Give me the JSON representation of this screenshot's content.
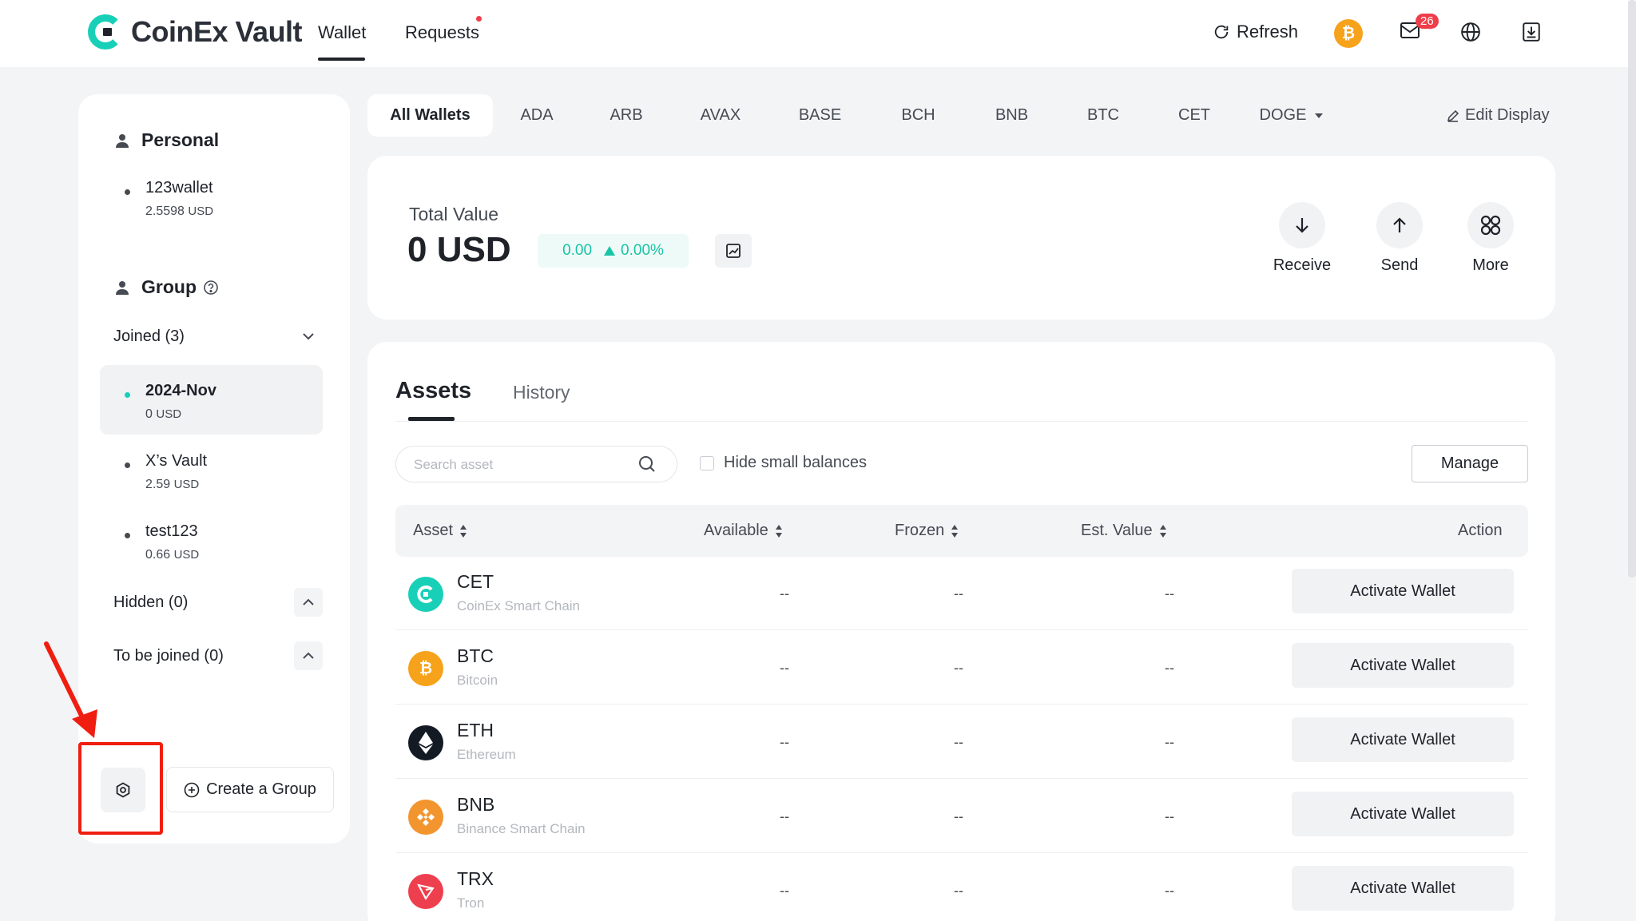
{
  "app": {
    "logo_text": "CoinEx Vault",
    "nav": {
      "wallet": "Wallet",
      "requests": "Requests"
    },
    "refresh": "Refresh",
    "coin_badge": "₿",
    "mail_count": "26"
  },
  "sidebar": {
    "personal_title": "Personal",
    "personal_wallets": [
      {
        "name": "123wallet",
        "amount": "2.5598",
        "unit": "USD"
      }
    ],
    "group_title": "Group",
    "joined_label": "Joined (3)",
    "joined_wallets": [
      {
        "name": "2024-Nov",
        "amount": "0",
        "unit": "USD"
      },
      {
        "name": "X’s Vault",
        "amount": "2.59",
        "unit": "USD"
      },
      {
        "name": "test123",
        "amount": "0.66",
        "unit": "USD"
      }
    ],
    "hidden_label": "Hidden (0)",
    "to_be_joined_label": "To be joined (0)",
    "create_group": "Create a Group"
  },
  "coin_tabs": [
    "All Wallets",
    "ADA",
    "ARB",
    "AVAX",
    "BASE",
    "BCH",
    "BNB",
    "BTC",
    "CET",
    "DOGE"
  ],
  "edit_display": "Edit Display",
  "total": {
    "label": "Total Value",
    "amount": "0 USD",
    "change_value": "0.00",
    "change_pct": "0.00%"
  },
  "actions": {
    "receive": "Receive",
    "send": "Send",
    "more": "More"
  },
  "assets": {
    "tab_assets": "Assets",
    "tab_history": "History",
    "search_placeholder": "Search asset",
    "hide_small": "Hide small balances",
    "manage": "Manage",
    "columns": {
      "asset": "Asset",
      "available": "Available",
      "frozen": "Frozen",
      "est_value": "Est. Value",
      "action": "Action"
    },
    "rows": [
      {
        "symbol": "CET",
        "chain": "CoinEx Smart Chain",
        "available": "--",
        "frozen": "--",
        "est_value": "--",
        "action": "Activate Wallet",
        "color": "#18d0b7"
      },
      {
        "symbol": "BTC",
        "chain": "Bitcoin",
        "available": "--",
        "frozen": "--",
        "est_value": "--",
        "action": "Activate Wallet",
        "color": "#f7a21b"
      },
      {
        "symbol": "ETH",
        "chain": "Ethereum",
        "available": "--",
        "frozen": "--",
        "est_value": "--",
        "action": "Activate Wallet",
        "color": "#141a24"
      },
      {
        "symbol": "BNB",
        "chain": "Binance Smart Chain",
        "available": "--",
        "frozen": "--",
        "est_value": "--",
        "action": "Activate Wallet",
        "color": "#f3952f"
      },
      {
        "symbol": "TRX",
        "chain": "Tron",
        "available": "--",
        "frozen": "--",
        "est_value": "--",
        "action": "Activate Wallet",
        "color": "#ee3f4f"
      }
    ]
  },
  "colors": {
    "accent": "#18d0b7",
    "positive": "#18c4a6",
    "badge": "#ef3e4a",
    "highlight": "#f01e10"
  }
}
